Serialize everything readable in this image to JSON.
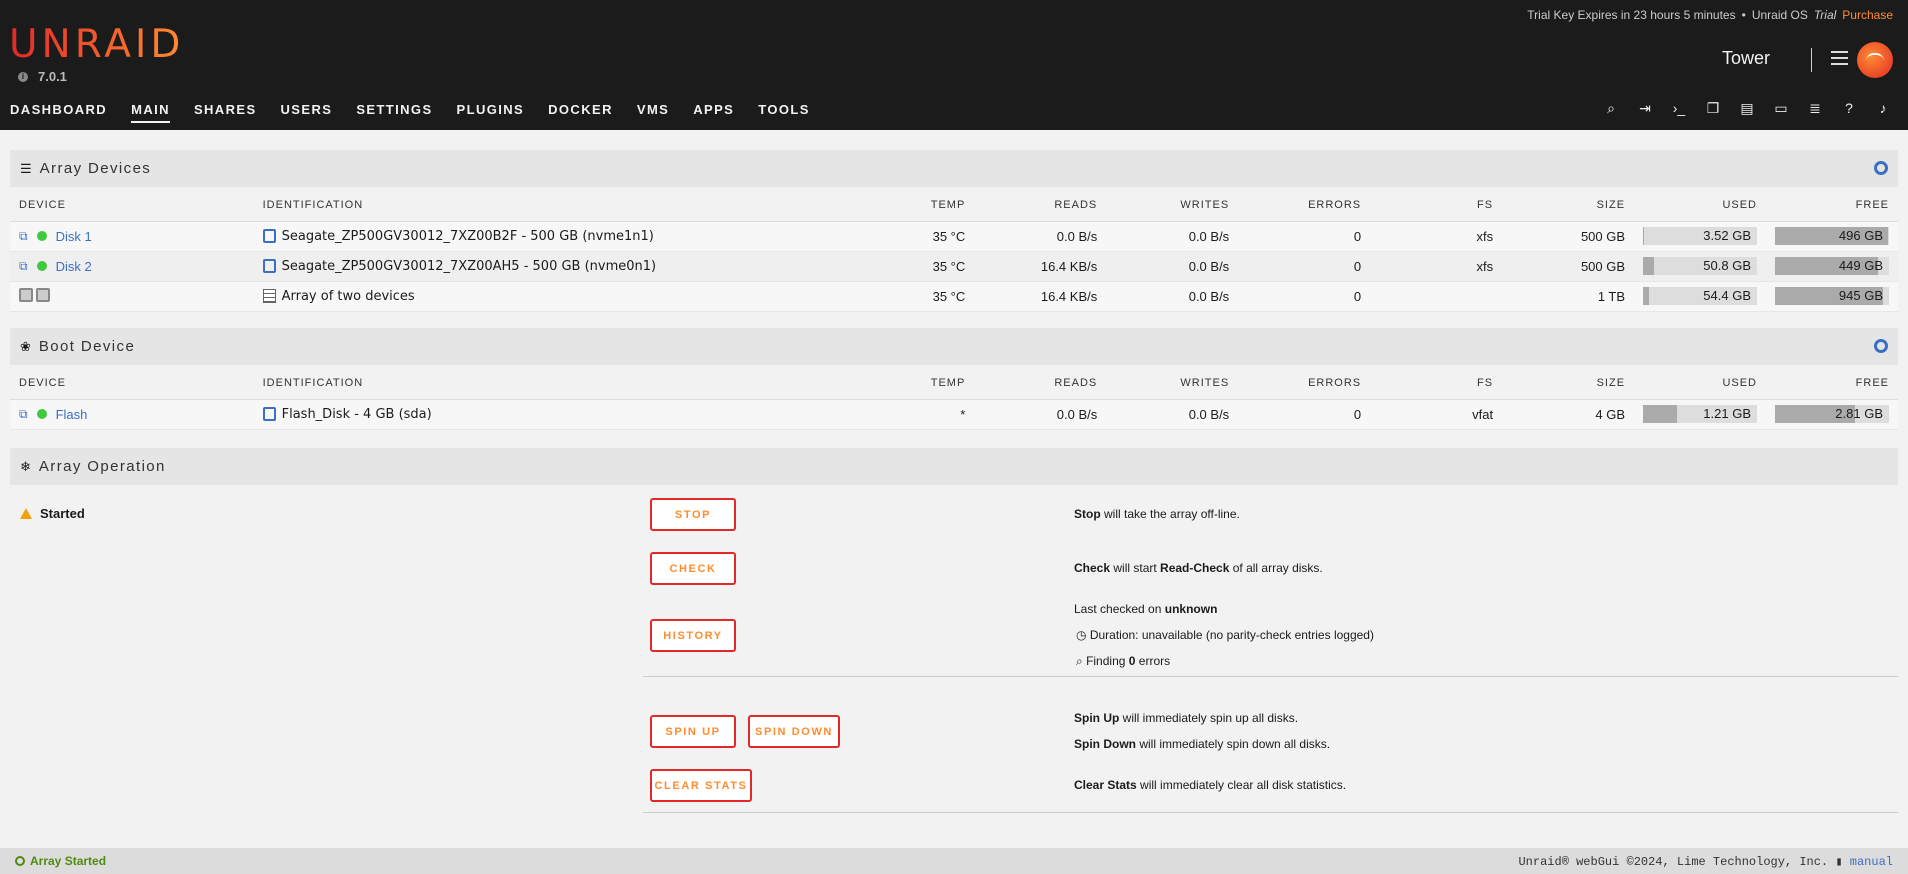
{
  "header": {
    "logo": "UNRAID",
    "version": "7.0.1",
    "trial_text": "Trial Key Expires in 23 hours 5 minutes",
    "bullet": "•",
    "os_name": "Unraid OS",
    "os_trial": "Trial",
    "purchase": "Purchase",
    "server_name": "Tower"
  },
  "nav": [
    "DASHBOARD",
    "MAIN",
    "SHARES",
    "USERS",
    "SETTINGS",
    "PLUGINS",
    "DOCKER",
    "VMS",
    "APPS",
    "TOOLS"
  ],
  "nav_active": "MAIN",
  "toolbar_icons": [
    "search-icon",
    "logout-icon",
    "terminal-icon",
    "copy-icon",
    "notes-icon",
    "display-icon",
    "log-icon",
    "help-icon",
    "bell-icon"
  ],
  "array_devices": {
    "title": "Array Devices",
    "headers": [
      "DEVICE",
      "IDENTIFICATION",
      "TEMP",
      "READS",
      "WRITES",
      "ERRORS",
      "FS",
      "SIZE",
      "USED",
      "FREE"
    ],
    "rows": [
      {
        "device": "Disk 1",
        "id": "Seagate_ZP500GV30012_7XZ00B2F - 500 GB (nvme1n1)",
        "temp": "35 °C",
        "reads": "0.0 B/s",
        "writes": "0.0 B/s",
        "errors": "0",
        "fs": "xfs",
        "size": "500 GB",
        "used": "3.52 GB",
        "used_pct": 1,
        "free": "496 GB",
        "free_pct": 99
      },
      {
        "device": "Disk 2",
        "id": "Seagate_ZP500GV30012_7XZ00AH5 - 500 GB (nvme0n1)",
        "temp": "35 °C",
        "reads": "16.4 KB/s",
        "writes": "0.0 B/s",
        "errors": "0",
        "fs": "xfs",
        "size": "500 GB",
        "used": "50.8 GB",
        "used_pct": 10,
        "free": "449 GB",
        "free_pct": 90
      },
      {
        "device": "",
        "id": "Array of two devices",
        "temp": "35 °C",
        "reads": "16.4 KB/s",
        "writes": "0.0 B/s",
        "errors": "0",
        "fs": "",
        "size": "1 TB",
        "used": "54.4 GB",
        "used_pct": 5,
        "free": "945 GB",
        "free_pct": 95
      }
    ]
  },
  "boot_device": {
    "title": "Boot Device",
    "headers": [
      "DEVICE",
      "IDENTIFICATION",
      "TEMP",
      "READS",
      "WRITES",
      "ERRORS",
      "FS",
      "SIZE",
      "USED",
      "FREE"
    ],
    "rows": [
      {
        "device": "Flash",
        "id": "Flash_Disk - 4 GB (sda)",
        "temp": "*",
        "reads": "0.0 B/s",
        "writes": "0.0 B/s",
        "errors": "0",
        "fs": "vfat",
        "size": "4 GB",
        "used": "1.21 GB",
        "used_pct": 30,
        "free": "2.81 GB",
        "free_pct": 70
      }
    ]
  },
  "array_operation": {
    "title": "Array Operation",
    "status": "Started",
    "buttons": {
      "stop": "STOP",
      "check": "CHECK",
      "history": "HISTORY",
      "spin_up": "SPIN UP",
      "spin_down": "SPIN DOWN",
      "clear_stats": "CLEAR STATS"
    },
    "stop_b": "Stop",
    "stop_t": " will take the array off-line.",
    "check_b": "Check",
    "check_t1": " will start ",
    "check_b2": "Read-Check",
    "check_t2": " of all array disks.",
    "last_checked_t": "Last checked on ",
    "last_checked_b": "unknown",
    "duration": "Duration: unavailable (no parity-check entries logged)",
    "finding_t1": "Finding ",
    "finding_b": "0",
    "finding_t2": " errors",
    "spinup_b": "Spin Up",
    "spinup_t": " will immediately spin up all disks.",
    "spindown_b": "Spin Down",
    "spindown_t": " will immediately spin down all disks.",
    "clear_b": "Clear Stats",
    "clear_t": " will immediately clear all disk statistics."
  },
  "footer": {
    "status": "Array Started",
    "copyright": "Unraid® webGui ©2024, Lime Technology, Inc.",
    "manual": "manual"
  }
}
